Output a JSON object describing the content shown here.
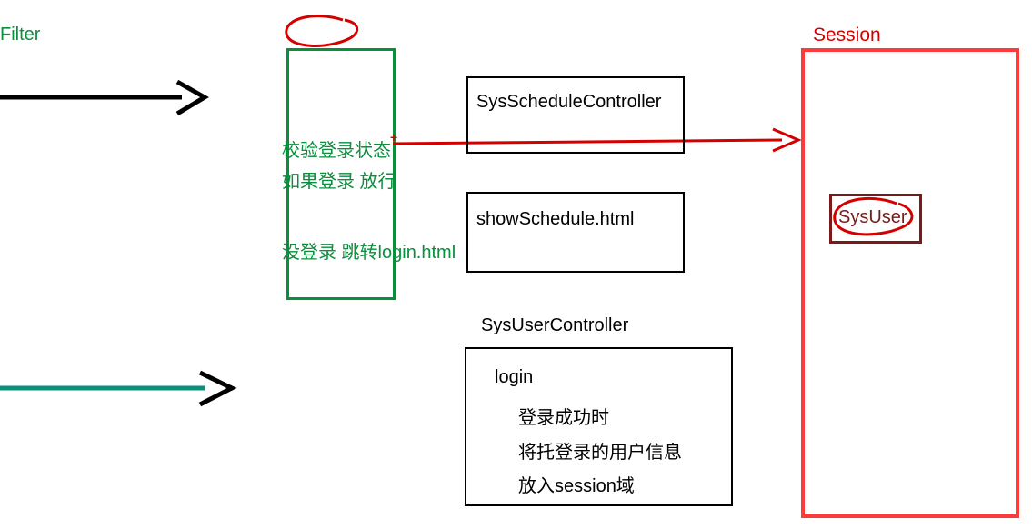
{
  "filter": {
    "title": "Filter",
    "line1": "校验登录状态",
    "line2": "如果登录 放行",
    "line3": "没登录 跳转login.html"
  },
  "sysScheduleController": {
    "label": "SysScheduleController"
  },
  "showSchedule": {
    "label": "showSchedule.html"
  },
  "sysUserController": {
    "title": "SysUserController",
    "login": "login",
    "l1": "登录成功时",
    "l2": "将托登录的用户信息",
    "l3": "放入session域"
  },
  "session": {
    "title": "Session",
    "sysUser": "SysUser"
  },
  "marks": {
    "cross": "+"
  }
}
